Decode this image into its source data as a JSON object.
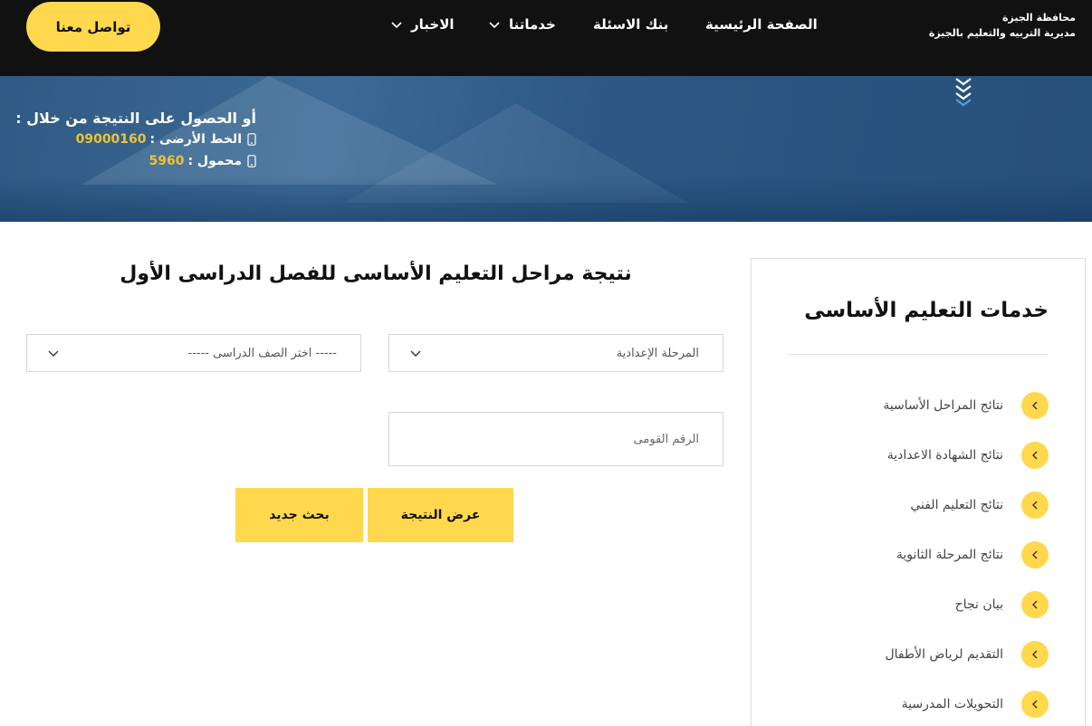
{
  "header": {
    "brand_line1": "محافظة الجيزة",
    "brand_line2": "مديرية التربيه والتعليم بالجيزة",
    "nav": [
      {
        "label": "الصفحة الرئيسية"
      },
      {
        "label": "بنك الاسئلة"
      },
      {
        "label": "خدماتنا"
      },
      {
        "label": "الاخبار"
      }
    ],
    "contact_label": "تواصل معنا"
  },
  "banner": {
    "lead": "أو الحصول على النتيجة من خلال :",
    "landline_label": "الخط الأرضى :",
    "landline_number": "09000160",
    "mobile_label": "محمول :",
    "mobile_number": "5960"
  },
  "form": {
    "title": "نتيجة مراحل التعليم الأساسى للفصل الدراسى الأول",
    "stage_select_value": "المرحلة الإعدادية",
    "grade_select_value": "----- اختر الصف الدراسى -----",
    "national_id_placeholder": "الرقم القومى",
    "show_result_label": "عرض النتيجة",
    "new_search_label": "بحث جديد"
  },
  "sidebar": {
    "title": "خدمات التعليم الأساسى",
    "items": [
      {
        "label": "نتائج المراحل الأساسية"
      },
      {
        "label": "نتائج الشهادة الاعدادية"
      },
      {
        "label": "نتائج التعليم الفني"
      },
      {
        "label": "نتائج المرحلة الثانوية"
      },
      {
        "label": "بيان نجاح"
      },
      {
        "label": "التقديم لرياض الأطفال"
      },
      {
        "label": "التحويلات المدرسية"
      }
    ]
  },
  "colors": {
    "accent": "#ffd84d",
    "header_bg": "#111111",
    "phone_text": "#f2c232"
  }
}
